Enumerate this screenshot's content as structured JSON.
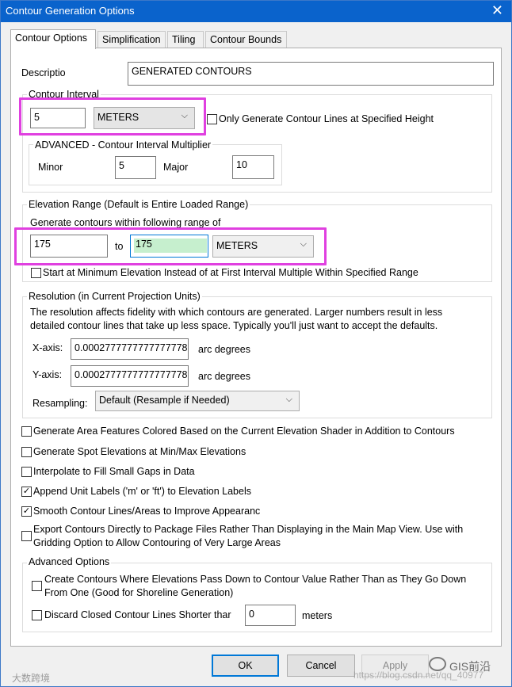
{
  "window": {
    "title": "Contour Generation Options",
    "close_glyph": "✕"
  },
  "tabs": [
    "Contour Options",
    "Simplification",
    "Tiling",
    "Contour Bounds"
  ],
  "description": {
    "label": "Descriptio",
    "value": "GENERATED CONTOURS"
  },
  "contour_interval": {
    "group_label": "Contour Interval",
    "value": "5",
    "units": "METERS",
    "only_specified_height_label": "Only Generate Contour Lines at Specified Height"
  },
  "advanced_multiplier": {
    "group_label": "ADVANCED - Contour Interval Multiplier",
    "minor_label": "Minor",
    "minor_value": "5",
    "major_label": "Major",
    "major_value": "10"
  },
  "elevation_range": {
    "group_label": "Elevation Range (Default is Entire Loaded Range)",
    "subtitle": "Generate contours within following range of",
    "from": "175",
    "to_label": "to",
    "to_value": "175",
    "units": "METERS",
    "start_min_label": "Start at Minimum Elevation Instead of at First Interval Multiple Within Specified Range"
  },
  "resolution": {
    "group_label": "Resolution (in Current Projection Units)",
    "description_line1": "The resolution affects fidelity with which contours are generated. Larger numbers result in less",
    "description_line2": "detailed contour lines that take up less space. Typically you'll just want to accept the defaults.",
    "x_label": "X-axis:",
    "x_value": "0.0002777777777777778",
    "x_unit": "arc degrees",
    "y_label": "Y-axis:",
    "y_value": "0.0002777777777777778",
    "y_unit": "arc degrees",
    "resampling_label": "Resampling:",
    "resampling_value": "Default (Resample if Needed)"
  },
  "options": [
    {
      "label": "Generate Area Features Colored Based on the Current Elevation Shader in Addition to Contours",
      "checked": false
    },
    {
      "label": "Generate Spot Elevations at Min/Max Elevations",
      "checked": false
    },
    {
      "label": "Interpolate to Fill Small Gaps in Data",
      "checked": false
    },
    {
      "label": "Append Unit Labels ('m' or 'ft') to Elevation Labels",
      "checked": true
    },
    {
      "label": "Smooth Contour Lines/Areas to Improve Appearanc",
      "checked": true
    }
  ],
  "export_option": {
    "line1": "Export Contours Directly to Package Files Rather Than Displaying in the Main Map View. Use with",
    "line2": "Gridding Option to Allow Contouring of Very Large Areas",
    "checked": false
  },
  "advanced_options": {
    "group_label": "Advanced Options",
    "shoreline_line1": "Create Contours Where Elevations Pass Down to Contour Value Rather Than as They Go Down",
    "shoreline_line2": "From One (Good for Shoreline Generation)",
    "discard_label": "Discard Closed Contour Lines Shorter thar",
    "discard_value": "0",
    "discard_unit": "meters"
  },
  "buttons": {
    "ok": "OK",
    "cancel": "Cancel",
    "apply": "Apply"
  },
  "watermarks": {
    "left": "大数跨境",
    "right": "GIS前沿",
    "url": "https://blog.csdn.net/qq_40977"
  },
  "icons": {
    "check_glyph": "✓",
    "chevron_glyph": "⌵"
  }
}
